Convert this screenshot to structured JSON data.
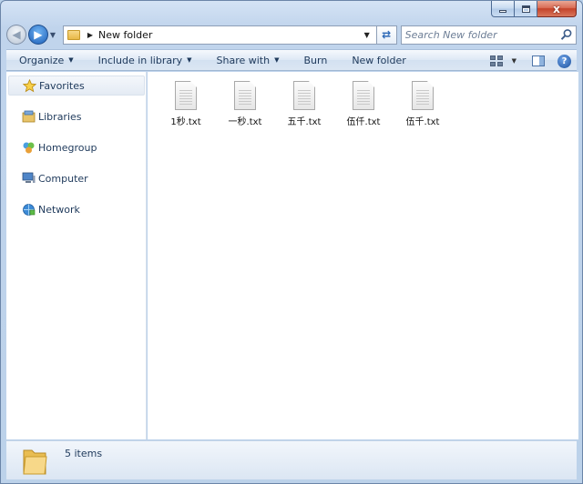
{
  "window": {
    "close_glyph": "x"
  },
  "navigation": {
    "breadcrumb": [
      "New folder"
    ],
    "search_placeholder": "Search New folder"
  },
  "toolbar": {
    "commands": [
      {
        "label": "Organize",
        "has_dropdown": true
      },
      {
        "label": "Include in library",
        "has_dropdown": true
      },
      {
        "label": "Share with",
        "has_dropdown": true
      },
      {
        "label": "Burn",
        "has_dropdown": false
      },
      {
        "label": "New folder",
        "has_dropdown": false
      }
    ],
    "help_glyph": "?"
  },
  "sidebar": {
    "items": [
      {
        "label": "Favorites",
        "icon": "star-icon",
        "selected": true
      },
      {
        "label": "Libraries",
        "icon": "library-icon"
      },
      {
        "label": "Homegroup",
        "icon": "homegroup-icon"
      },
      {
        "label": "Computer",
        "icon": "computer-icon"
      },
      {
        "label": "Network",
        "icon": "network-icon"
      }
    ]
  },
  "files": [
    {
      "name": "1秒.txt",
      "icon": "text-file-icon"
    },
    {
      "name": "一秒.txt",
      "icon": "text-file-icon"
    },
    {
      "name": "五千.txt",
      "icon": "text-file-icon"
    },
    {
      "name": "伍仟.txt",
      "icon": "text-file-icon"
    },
    {
      "name": "伍千.txt",
      "icon": "text-file-icon"
    }
  ],
  "status": {
    "item_count": "5 items"
  },
  "colors": {
    "accent": "#1e395b",
    "frame": "#bcd2ea",
    "close": "#c4432a"
  }
}
